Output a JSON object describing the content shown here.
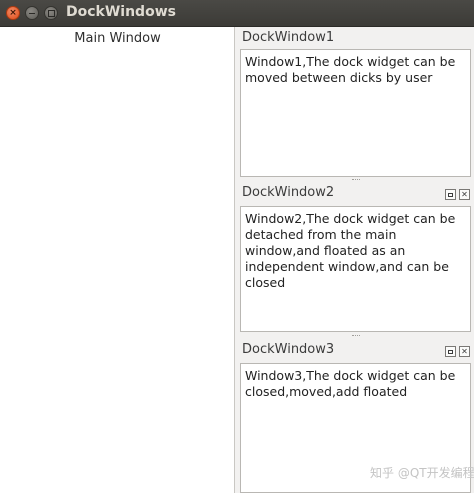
{
  "window": {
    "title": "DockWindows"
  },
  "main": {
    "label": "Main Window"
  },
  "docks": [
    {
      "title": "DockWindow1",
      "text": "Window1,The dock widget can be moved between dicks by user",
      "closable": false,
      "floatable": false
    },
    {
      "title": "DockWindow2",
      "text": "Window2,The dock widget can be detached from the main window,and floated as an independent window,and can be closed",
      "closable": true,
      "floatable": true
    },
    {
      "title": "DockWindow3",
      "text": "Window3,The dock widget can be closed,moved,add floated",
      "closable": true,
      "floatable": true
    }
  ],
  "icons": {
    "close": "x-glyph",
    "float": "float-glyph"
  },
  "watermark": "知乎 @QT开发编程"
}
